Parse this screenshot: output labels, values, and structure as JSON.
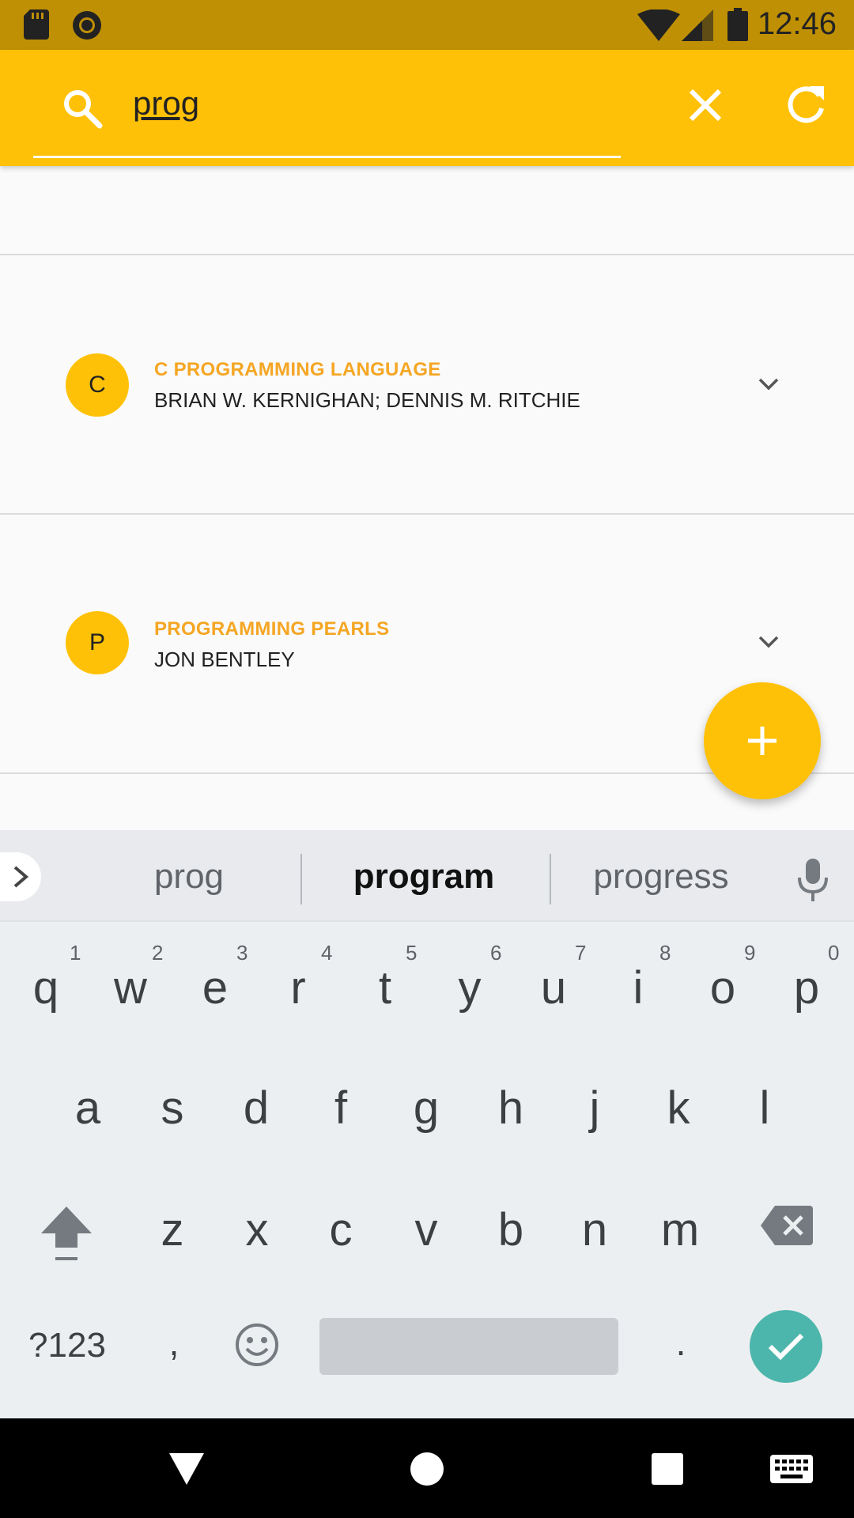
{
  "status_bar": {
    "time": "12:46"
  },
  "search": {
    "query": "prog",
    "placeholder": ""
  },
  "books": [
    {
      "initial": "C",
      "title": "C PROGRAMMING LANGUAGE",
      "author": "BRIAN W. KERNIGHAN; DENNIS M. RITCHIE"
    },
    {
      "initial": "P",
      "title": "PROGRAMMING PEARLS",
      "author": "JON BENTLEY"
    }
  ],
  "keyboard": {
    "suggestions": [
      "prog",
      "program",
      "progress"
    ],
    "row1": [
      "q",
      "w",
      "e",
      "r",
      "t",
      "y",
      "u",
      "i",
      "o",
      "p"
    ],
    "row1_hints": [
      "1",
      "2",
      "3",
      "4",
      "5",
      "6",
      "7",
      "8",
      "9",
      "0"
    ],
    "row2": [
      "a",
      "s",
      "d",
      "f",
      "g",
      "h",
      "j",
      "k",
      "l"
    ],
    "row3": [
      "z",
      "x",
      "c",
      "v",
      "b",
      "n",
      "m"
    ],
    "symbols_label": "?123",
    "comma": ",",
    "period": "."
  },
  "colors": {
    "primary": "#ffc107",
    "status_bar": "#bf9004",
    "accent_text": "#f5a623",
    "enter": "#4db6ac"
  }
}
